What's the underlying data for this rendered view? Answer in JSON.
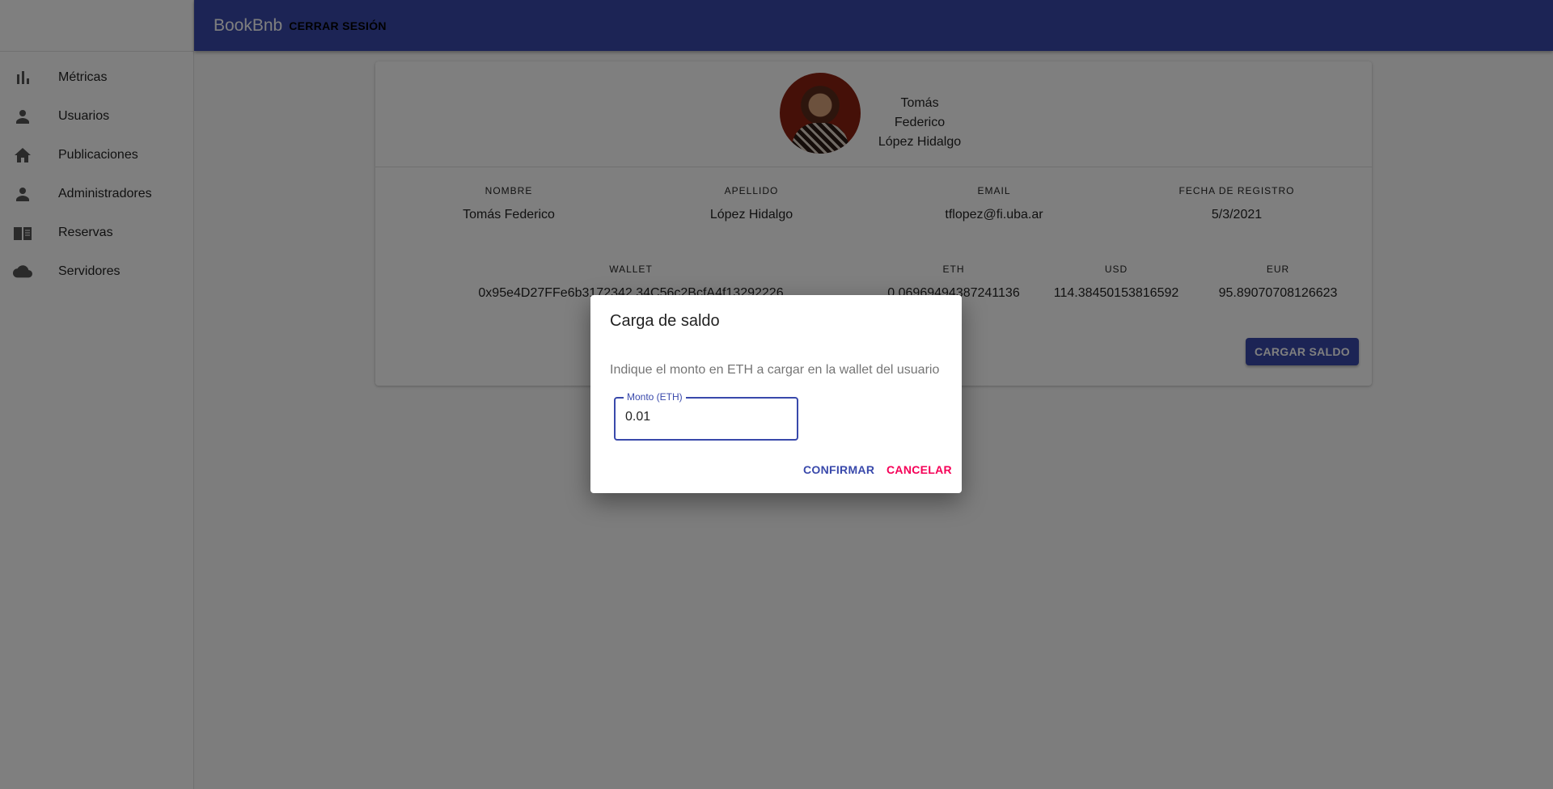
{
  "sidebar": {
    "items": [
      {
        "label": "Métricas",
        "icon": "bar-chart-icon"
      },
      {
        "label": "Usuarios",
        "icon": "person-icon"
      },
      {
        "label": "Publicaciones",
        "icon": "home-icon"
      },
      {
        "label": "Administradores",
        "icon": "person-icon"
      },
      {
        "label": "Reservas",
        "icon": "book-icon"
      },
      {
        "label": "Servidores",
        "icon": "cloud-icon"
      }
    ]
  },
  "header": {
    "brand": "BookBnb",
    "logout": "CERRAR SESIÓN"
  },
  "profile": {
    "first_line": "Tomás Federico",
    "second_line": "López Hidalgo",
    "fields": [
      {
        "label": "NOMBRE",
        "value": "Tomás Federico"
      },
      {
        "label": "APELLIDO",
        "value": "López Hidalgo"
      },
      {
        "label": "EMAIL",
        "value": "tflopez@fi.uba.ar"
      },
      {
        "label": "FECHA DE REGISTRO",
        "value": "5/3/2021"
      }
    ],
    "wallet": [
      {
        "label": "WALLET",
        "value": "0x95e4D27FFe6b3172342 34C56c2BcfA4f13292226"
      },
      {
        "label": "ETH",
        "value": "0.06969494387241136"
      },
      {
        "label": "USD",
        "value": "114.38450153816592"
      },
      {
        "label": "EUR",
        "value": "95.89070708126623"
      }
    ],
    "load_button": "CARGAR SALDO"
  },
  "dialog": {
    "title": "Carga de saldo",
    "text": "Indique el monto en ETH a cargar en la wallet del usuario",
    "field_label": "Monto (ETH)",
    "field_value": "0.01",
    "confirm": "CONFIRMAR",
    "cancel": "CANCELAR"
  },
  "colors": {
    "primary": "#3949ab",
    "secondary": "#f50057"
  }
}
